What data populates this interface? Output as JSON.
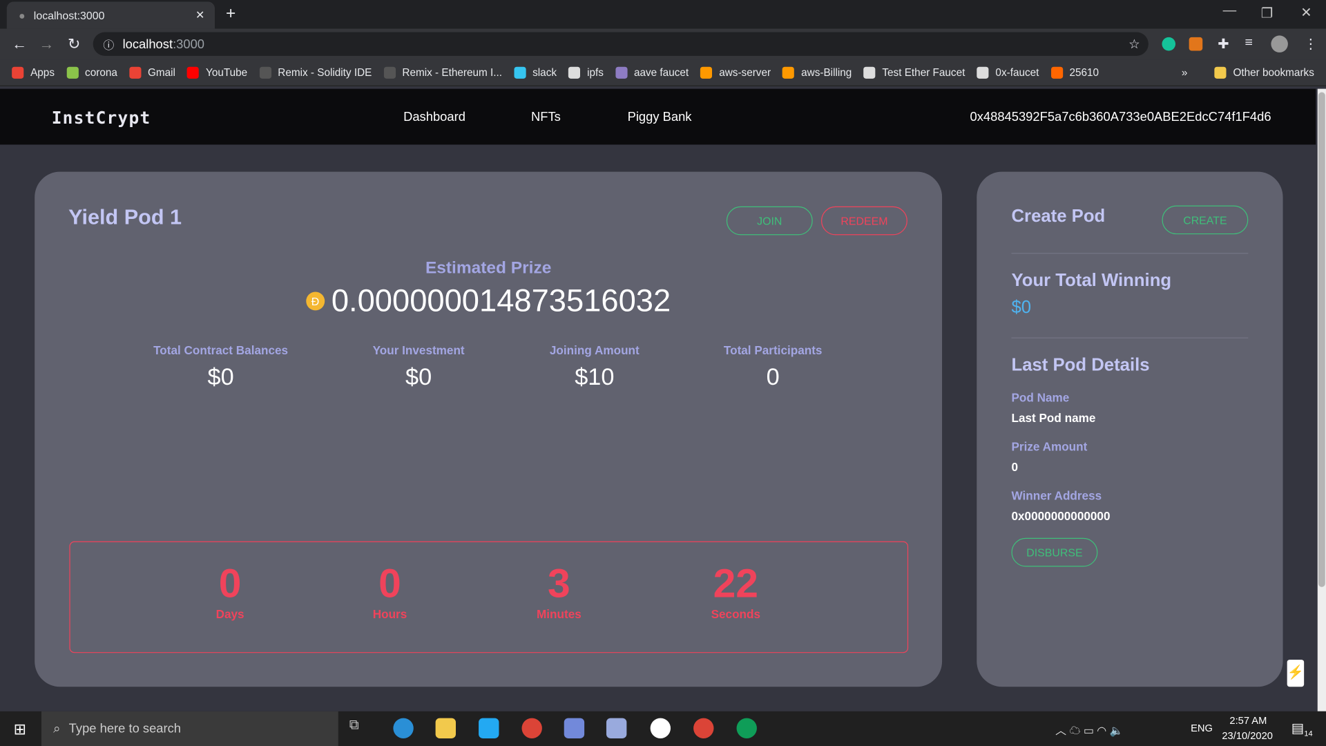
{
  "browser": {
    "tab_title": "localhost:3000",
    "url_host": "localhost",
    "url_port": ":3000",
    "bookmarks": [
      {
        "label": "Apps",
        "color": "#ea4335"
      },
      {
        "label": "corona",
        "color": "#8bc34a"
      },
      {
        "label": "Gmail",
        "color": "#ea4335"
      },
      {
        "label": "YouTube",
        "color": "#ff0000"
      },
      {
        "label": "Remix - Solidity IDE",
        "color": "#555"
      },
      {
        "label": "Remix - Ethereum I...",
        "color": "#555"
      },
      {
        "label": "slack",
        "color": "#36c5f0"
      },
      {
        "label": "ipfs",
        "color": "#ddd"
      },
      {
        "label": "aave faucet",
        "color": "#8e7cc3"
      },
      {
        "label": "aws-server",
        "color": "#f90"
      },
      {
        "label": "aws-Billing",
        "color": "#f90"
      },
      {
        "label": "Test Ether Faucet",
        "color": "#ddd"
      },
      {
        "label": "0x-faucet",
        "color": "#ddd"
      },
      {
        "label": "25610",
        "color": "#f60"
      }
    ],
    "overflow": "»",
    "other_bookmarks": "Other bookmarks"
  },
  "app": {
    "brand": "InstCrypt",
    "nav": [
      "Dashboard",
      "NFTs",
      "Piggy Bank"
    ],
    "wallet": "0x48845392F5a7c6b360A733e0ABE2EdcC74f1F4d6"
  },
  "pod": {
    "title": "Yield Pod 1",
    "join": "JOIN",
    "redeem": "REDEEM",
    "prize_label": "Estimated Prize",
    "prize_value": "0.000000014873516032",
    "stats": [
      {
        "label": "Total Contract Balances",
        "value": "$0"
      },
      {
        "label": "Your Investment",
        "value": "$0"
      },
      {
        "label": "Joining Amount",
        "value": "$10"
      },
      {
        "label": "Total Participants",
        "value": "0"
      }
    ],
    "countdown": [
      {
        "value": "0",
        "unit": "Days"
      },
      {
        "value": "0",
        "unit": "Hours"
      },
      {
        "value": "3",
        "unit": "Minutes"
      },
      {
        "value": "22",
        "unit": "Seconds"
      }
    ]
  },
  "side": {
    "create_title": "Create Pod",
    "create": "CREATE",
    "winning_title": "Your Total Winning",
    "winning_value": "$0",
    "last_title": "Last Pod Details",
    "fields": [
      {
        "label": "Pod Name",
        "value": "Last Pod name"
      },
      {
        "label": "Prize Amount",
        "value": "0"
      },
      {
        "label": "Winner Address",
        "value": "0x0000000000000"
      }
    ],
    "disburse": "DISBURSE"
  },
  "taskbar": {
    "search_placeholder": "Type here to search",
    "lang": "ENG",
    "time": "2:57 AM",
    "date": "23/10/2020",
    "notif": "14"
  },
  "colors": {
    "accent_green": "#3fbf7a",
    "accent_red": "#f0435b",
    "card": "#61626f",
    "background": "#34353f"
  }
}
